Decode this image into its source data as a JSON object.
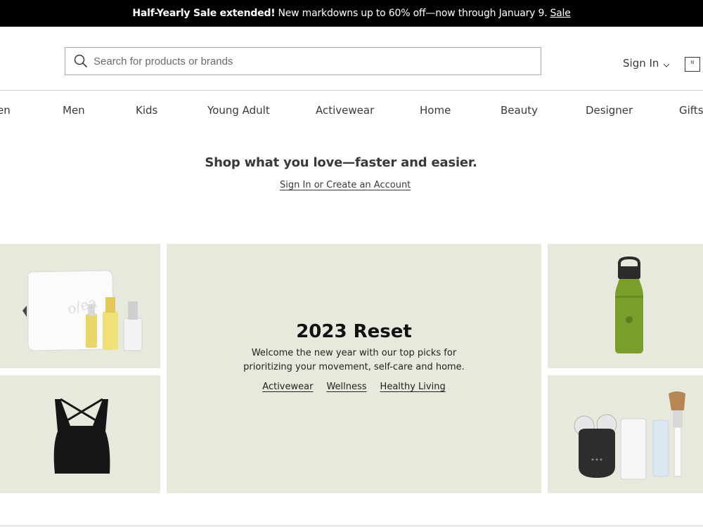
{
  "promo": {
    "bold": "Half-Yearly Sale extended!",
    "text": "New markdowns up to 60% off—now through January 9.",
    "link": "Sale"
  },
  "header": {
    "search_placeholder": "Search for products or brands",
    "search_icon": "search-icon",
    "signin": "Sign In",
    "bag_icon": "shopping-bag-icon",
    "bag_letters": "N"
  },
  "nav": {
    "items": [
      "en",
      "Men",
      "Kids",
      "Young Adult",
      "Activewear",
      "Home",
      "Beauty",
      "Designer",
      "Gifts"
    ]
  },
  "hero": {
    "title": "Shop what you love—faster and easier.",
    "link": "Sign In or Create an Account"
  },
  "feature": {
    "title": "2023 Reset",
    "text_line1": "Welcome the new year with our top picks for",
    "text_line2": "prioritizing your movement, self-care and home.",
    "links": [
      "Activewear",
      "Wellness",
      "Healthy Living"
    ]
  },
  "products": {
    "topleft": "skincare-kit-image",
    "bottomleft": "crop-top-image",
    "topright": "water-bottle-image",
    "bottomright": "face-device-image"
  },
  "colors": {
    "tile_bg": "#e7e9dd",
    "text": "#393939",
    "bottle_green": "#7a9e2a"
  }
}
